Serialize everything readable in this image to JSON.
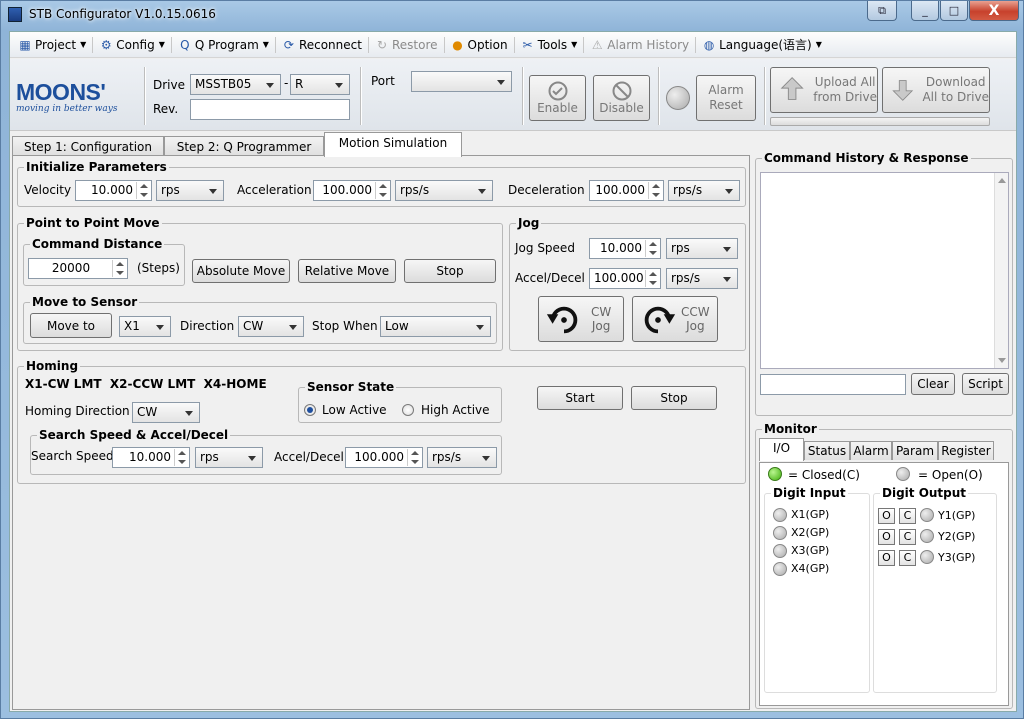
{
  "window": {
    "title": "STB Configurator V1.0.15.0616",
    "min_label": "_",
    "max_label": "□",
    "close_label": "X",
    "extra_label": "⧉"
  },
  "menu": {
    "items": [
      {
        "label": "Project",
        "icon": "project-icon",
        "glyph": "▦",
        "dropdown": true,
        "disabled": false
      },
      {
        "label": "Config",
        "icon": "config-icon",
        "glyph": "⚙",
        "dropdown": true,
        "disabled": false
      },
      {
        "label": "Q Program",
        "icon": "q-program-icon",
        "glyph": "Q",
        "dropdown": true,
        "disabled": false
      },
      {
        "label": "Reconnect",
        "icon": "reconnect-icon",
        "glyph": "⟳",
        "dropdown": false,
        "disabled": false
      },
      {
        "label": "Restore",
        "icon": "restore-icon",
        "glyph": "↻",
        "dropdown": false,
        "disabled": true
      },
      {
        "label": "Option",
        "icon": "option-icon",
        "glyph": "●",
        "dropdown": false,
        "disabled": false
      },
      {
        "label": "Tools",
        "icon": "tools-icon",
        "glyph": "✂",
        "dropdown": true,
        "disabled": false
      },
      {
        "label": "Alarm History",
        "icon": "alarm-history-icon",
        "glyph": "⚠",
        "dropdown": false,
        "disabled": true
      },
      {
        "label": "Language(语言)",
        "icon": "language-icon",
        "glyph": "◍",
        "dropdown": true,
        "disabled": false
      }
    ]
  },
  "toolbar": {
    "logo_brand": "MOONS'",
    "logo_slogan": "moving in better ways",
    "drive_label": "Drive",
    "drive_value": "MSSTB05",
    "dash": "-",
    "drive_suffix": "R",
    "rev_label": "Rev.",
    "rev_value": "",
    "port_label": "Port",
    "port_value": "",
    "enable_label": "Enable",
    "disable_label": "Disable",
    "alarm_reset_line1": "Alarm",
    "alarm_reset_line2": "Reset",
    "upload_line1": "Upload All",
    "upload_line2": "from Drive",
    "download_line1": "Download",
    "download_line2": "All to Drive"
  },
  "tabs": [
    "Step 1: Configuration",
    "Step 2: Q Programmer",
    "Motion Simulation"
  ],
  "init": {
    "title": "Initialize Parameters",
    "velocity_label": "Velocity",
    "velocity": "10.000",
    "velocity_unit": "rps",
    "accel_label": "Acceleration",
    "accel": "100.000",
    "accel_unit": "rps/s",
    "decel_label": "Deceleration",
    "decel": "100.000",
    "decel_unit": "rps/s"
  },
  "p2p": {
    "title": "Point to Point Move",
    "cmd_title": "Command Distance",
    "distance": "20000",
    "steps_label": "(Steps)",
    "abs_label": "Absolute Move",
    "rel_label": "Relative Move",
    "stop_label": "Stop",
    "sensor_title": "Move to Sensor",
    "move_to_label": "Move to",
    "input_value": "X1",
    "direction_label": "Direction",
    "direction_value": "CW",
    "stop_when_label": "Stop When",
    "stop_when_value": "Low"
  },
  "jog": {
    "title": "Jog",
    "speed_label": "Jog Speed",
    "speed": "10.000",
    "speed_unit": "rps",
    "accel_label": "Accel/Decel",
    "accel": "100.000",
    "accel_unit": "rps/s",
    "cw_line1": "CW",
    "cw_line2": "Jog",
    "ccw_line1": "CCW",
    "ccw_line2": "Jog"
  },
  "homing": {
    "title": "Homing",
    "io_text": "X1-CW LMT  X2-CCW LMT  X4-HOME",
    "dir_label": "Homing Direction",
    "dir_value": "CW",
    "sensor_title": "Sensor State",
    "low_label": "Low Active",
    "high_label": "High Active",
    "low_selected": true,
    "start_label": "Start",
    "stop_label": "Stop",
    "search_title": "Search Speed & Accel/Decel",
    "search_label": "Search Speed",
    "search_speed": "10.000",
    "search_unit": "rps",
    "accel_label": "Accel/Decel",
    "accel": "100.000",
    "accel_unit": "rps/s"
  },
  "history": {
    "title": "Command History & Response",
    "input_value": "",
    "clear_label": "Clear",
    "script_label": "Script"
  },
  "monitor": {
    "title": "Monitor",
    "tabs": [
      "I/O",
      "Status",
      "Alarm",
      "Param",
      "Register"
    ],
    "closed_label": "= Closed(C)",
    "open_label": "= Open(O)",
    "digit_input_title": "Digit Input",
    "inputs": [
      "X1(GP)",
      "X2(GP)",
      "X3(GP)",
      "X4(GP)"
    ],
    "digit_output_title": "Digit Output",
    "outputs": [
      "Y1(GP)",
      "Y2(GP)",
      "Y3(GP)"
    ],
    "o_label": "O",
    "c_label": "C"
  },
  "colors": {
    "closed_led": "#3fae0c",
    "brand": "#1d4f9c",
    "title_bar": "#9cbfe0"
  }
}
